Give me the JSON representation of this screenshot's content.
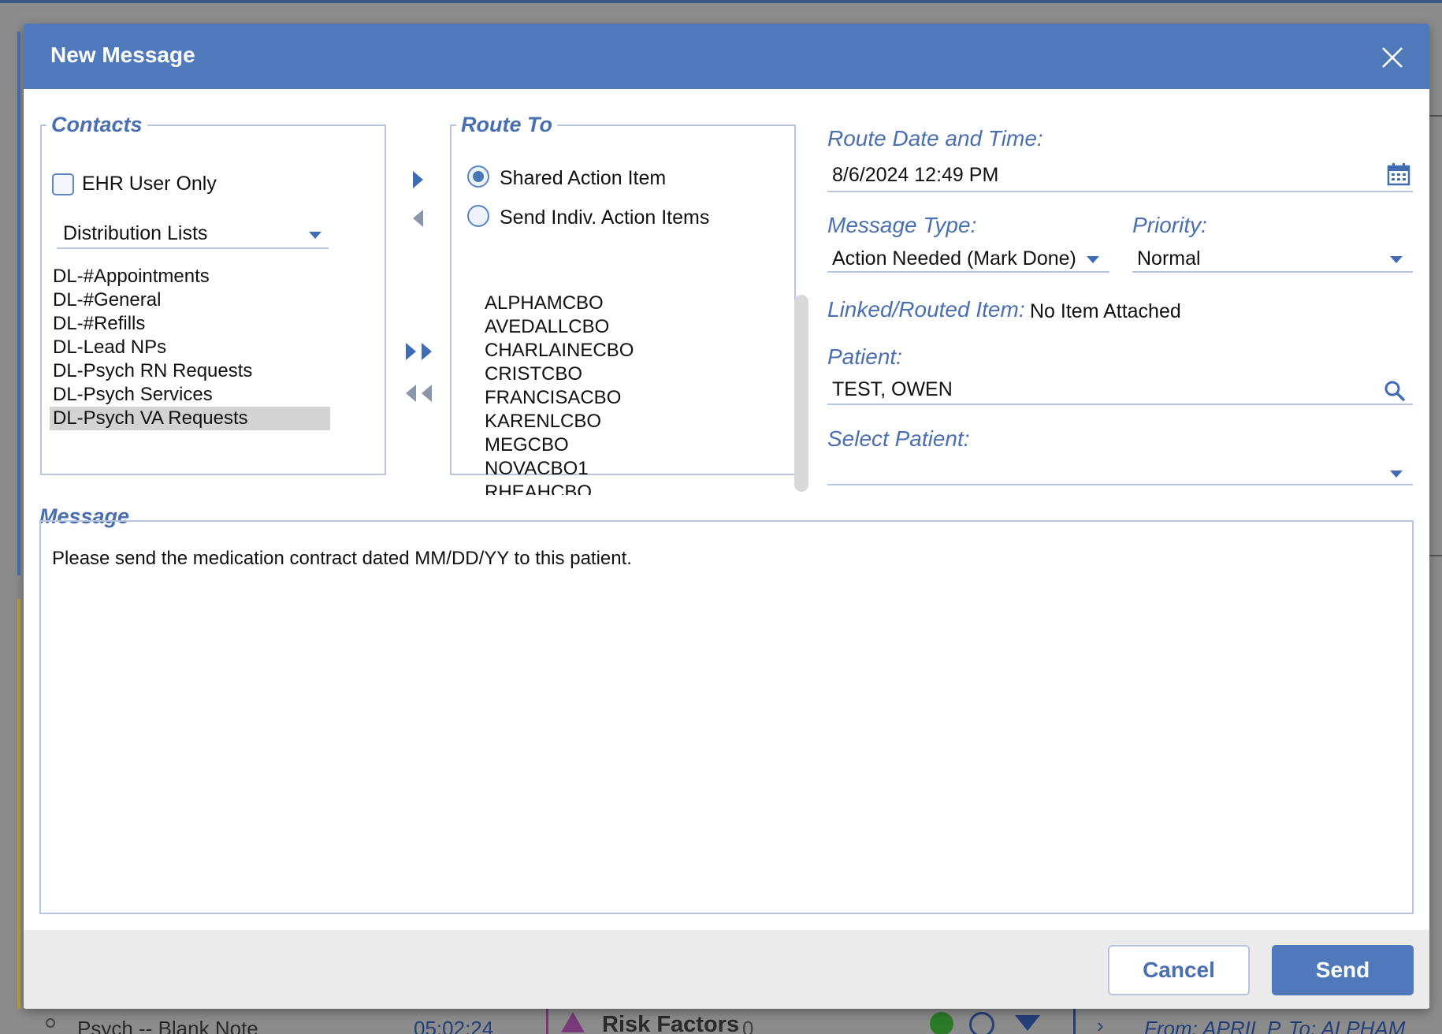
{
  "modal": {
    "title": "New Message"
  },
  "contacts": {
    "legend": "Contacts",
    "ehr_user_only_label": "EHR User Only",
    "ehr_user_only_checked": false,
    "list_type": "Distribution Lists",
    "items": [
      "DL-#Appointments",
      "DL-#General",
      "DL-#Refills",
      "DL-Lead NPs",
      "DL-Psych RN Requests",
      "DL-Psych Services",
      "DL-Psych VA Requests"
    ],
    "selected_item": "DL-Psych VA Requests"
  },
  "route_to": {
    "legend": "Route To",
    "options": [
      "Shared Action Item",
      "Send Indiv. Action Items"
    ],
    "selected_option": "Shared Action Item",
    "recipients": [
      "ALPHAMCBO",
      "AVEDALLCBO",
      "CHARLAINECBO",
      "CRISTCBO",
      "FRANCISACBO",
      "KARENLCBO",
      "MEGCBO",
      "NOVACBO1",
      "RHEAHCBO"
    ]
  },
  "details": {
    "route_date_label": "Route Date and Time:",
    "route_date_value": "8/6/2024 12:49 PM",
    "message_type_label": "Message Type:",
    "message_type_value": "Action Needed (Mark Done)",
    "priority_label": "Priority:",
    "priority_value": "Normal",
    "linked_label": "Linked/Routed Item:",
    "linked_value": "No Item Attached",
    "patient_label": "Patient:",
    "patient_value": "TEST, OWEN",
    "select_patient_label": "Select Patient:",
    "select_patient_value": ""
  },
  "message": {
    "label": "Message",
    "text": "Please send the medication contract dated MM/DD/YY to this patient."
  },
  "buttons": {
    "cancel": "Cancel",
    "send": "Send"
  },
  "background": {
    "note_title": "Psych -- Blank Note",
    "note_time": "05:02:24",
    "risk_title": "Risk Factors",
    "risk_count": "0",
    "from": "From: APRIL P",
    "to": "To: ALPHAM"
  },
  "colors": {
    "header": "#5079bb",
    "accent_label": "#4a6fb0",
    "border": "#b7c6de",
    "selected_row": "#d3d3d3"
  }
}
